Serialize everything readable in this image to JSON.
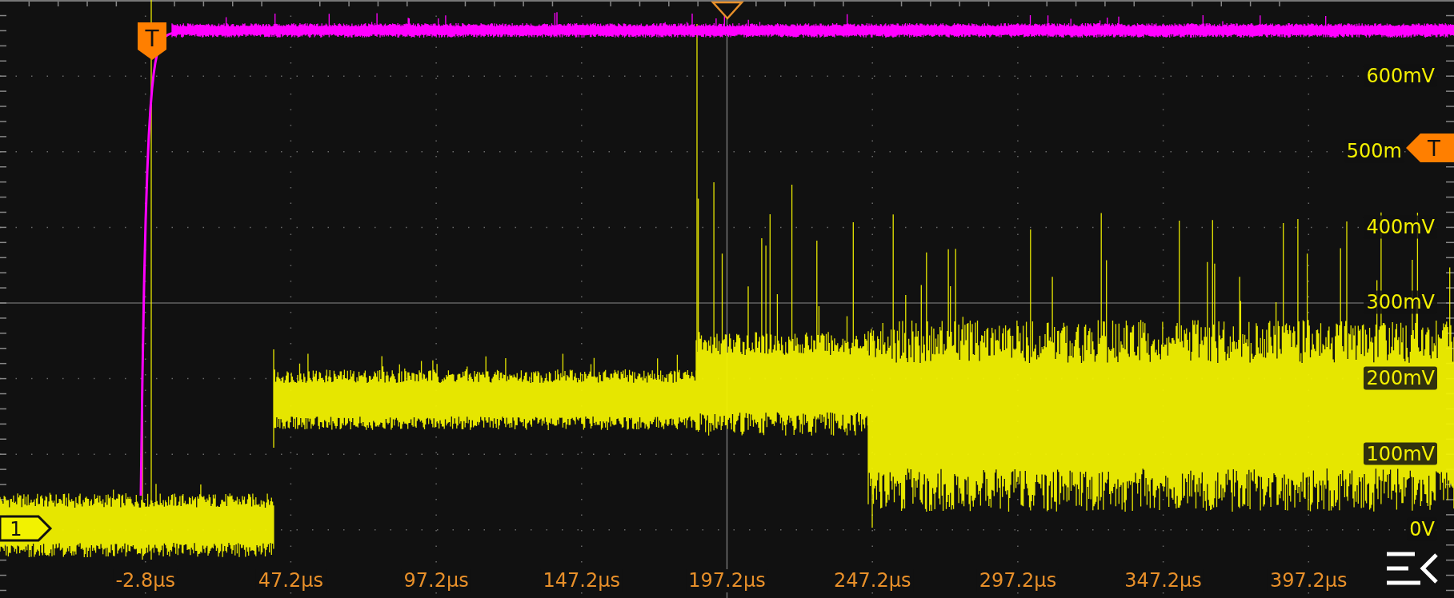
{
  "time_axis": {
    "labels": [
      "-2.8µs",
      "47.2µs",
      "97.2µs",
      "147.2µs",
      "197.2µs",
      "247.2µs",
      "297.2µs",
      "347.2µs",
      "397.2µs"
    ]
  },
  "voltage_axis": {
    "labels": [
      "600mV",
      "500m",
      "400mV",
      "300mV",
      "200mV",
      "100mV",
      "0V"
    ]
  },
  "markers": [
    {
      "kind": "trigger-position",
      "text": "T"
    },
    {
      "kind": "trigger-level",
      "text": "T"
    },
    {
      "kind": "channel",
      "text": "1"
    },
    {
      "kind": "time-reference"
    }
  ],
  "menu": {
    "kind": "menu-button"
  }
}
